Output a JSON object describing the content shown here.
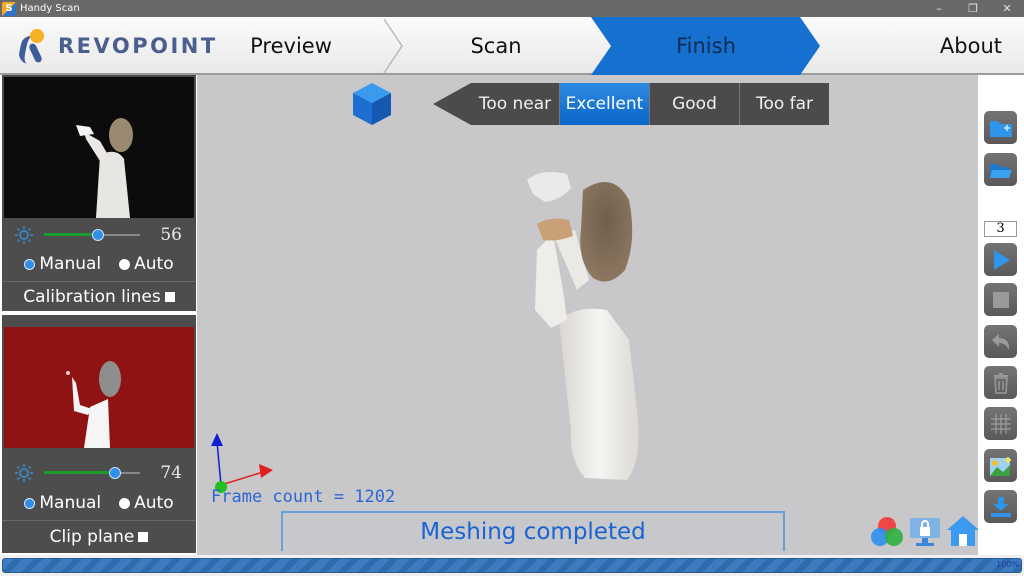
{
  "window": {
    "title": "Handy Scan",
    "controls": [
      "minimize",
      "maximize",
      "close"
    ]
  },
  "header": {
    "brand": "REVOPOINT",
    "steps": [
      {
        "label": "Preview",
        "active": false
      },
      {
        "label": "Scan",
        "active": false
      },
      {
        "label": "Finish",
        "active": true
      }
    ],
    "about_label": "About",
    "accent_color": "#0a6ccf"
  },
  "left_panel": {
    "camera_top": {
      "view": "texture camera preview",
      "brightness_value": "56",
      "brightness_fraction": 0.56,
      "mode_options": [
        {
          "label": "Manual",
          "selected": true
        },
        {
          "label": "Auto",
          "selected": false
        }
      ],
      "checkbox_label": "Calibration lines",
      "checkbox_checked": false
    },
    "camera_bottom": {
      "view": "depth camera preview",
      "brightness_value": "74",
      "brightness_fraction": 0.74,
      "mode_options": [
        {
          "label": "Manual",
          "selected": true
        },
        {
          "label": "Auto",
          "selected": false
        }
      ],
      "checkbox_label": "Clip plane",
      "checkbox_checked": false
    }
  },
  "viewport": {
    "distance_indicator": [
      {
        "label": "Too near",
        "active": false
      },
      {
        "label": "Excellent",
        "active": true
      },
      {
        "label": "Good",
        "active": false
      },
      {
        "label": "Too far",
        "active": false
      }
    ],
    "frame_count_text": "Frame count = 1202",
    "status_text": "Meshing completed",
    "bottom_icons": [
      "color-mode-icon",
      "lock-screen-icon",
      "home-icon"
    ]
  },
  "right_toolbar": {
    "items": [
      {
        "name": "new-project-icon"
      },
      {
        "name": "open-project-icon"
      },
      {
        "name": "count-field",
        "value": "3"
      },
      {
        "name": "play-icon"
      },
      {
        "name": "stop-icon"
      },
      {
        "name": "undo-icon"
      },
      {
        "name": "delete-icon"
      },
      {
        "name": "mesh-icon"
      },
      {
        "name": "texture-icon"
      },
      {
        "name": "export-icon"
      }
    ]
  },
  "progress": {
    "value_text": "100%",
    "fraction": 1.0
  }
}
